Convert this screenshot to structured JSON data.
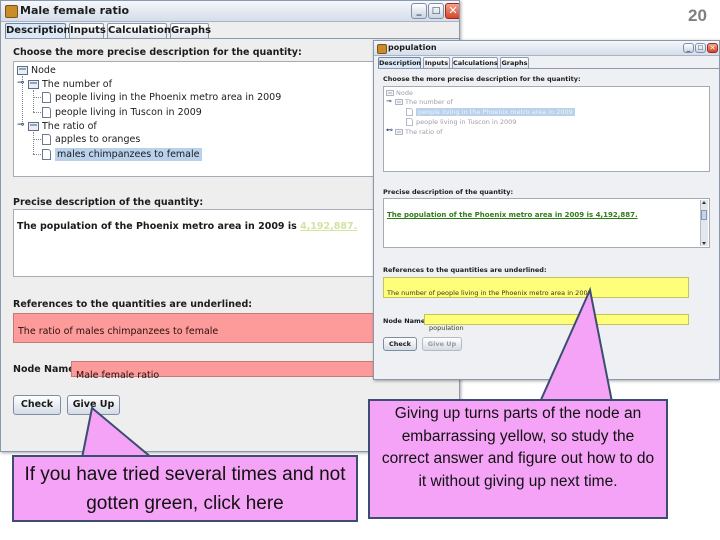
{
  "slide": {
    "page_number": "20"
  },
  "main_window": {
    "title": "Male female ratio",
    "tabs": [
      "Description",
      "Inputs",
      "Calculations",
      "Graphs"
    ],
    "choose_label": "Choose the more precise description for the quantity:",
    "tree": {
      "root": "Node",
      "groups": [
        {
          "label": "The number of",
          "items": [
            "people living in the Phoenix metro area in 2009",
            "people living in Tuscon in 2009"
          ]
        },
        {
          "label": "The ratio of",
          "items": [
            "apples to oranges",
            "males chimpanzees to female"
          ]
        }
      ]
    },
    "precise_label": "Precise description of the quantity:",
    "precise_text": "The population of the Phoenix metro area in 2009 is ",
    "precise_value": "4,192,887.",
    "references_label": "References to the quantities are underlined:",
    "references_text": "The ratio of males chimpanzees to female",
    "node_name_label": "Node Name:",
    "node_name_value": "Male female ratio",
    "check_label": "Check",
    "give_up_label": "Give Up"
  },
  "popup_window": {
    "title": "population",
    "tabs": [
      "Description",
      "Inputs",
      "Calculations",
      "Graphs"
    ],
    "choose_label": "Choose the more precise description for the quantity:",
    "tree": {
      "root": "Node",
      "group1": "The number of",
      "items": [
        "people living in the Phoenix metro area in 2009",
        "people living in Tuscon in 2009"
      ],
      "group2": "The ratio of"
    },
    "precise_label": "Precise description of the quantity:",
    "precise_text": "The population of the Phoenix metro area in 2009 is 4,192,887.",
    "references_label": "References to the quantities are underlined:",
    "references_text": "The number of people living in the Phoenix metro area in 2009",
    "node_name_label": "Node Name:",
    "node_name_value": "population",
    "check_label": "Check",
    "give_up_label": "Give Up"
  },
  "callouts": {
    "left": "If you have tried several times and not gotten green, click here",
    "right": "Giving up turns parts of the node an embarrassing yellow, so study the correct answer and figure out how to do it without giving up next time."
  },
  "colors": {
    "error_pink": "#fd9a9a",
    "giveup_yellow": "#fefe7a",
    "green_text": "#2f7d18",
    "selection": "#b9d1ea",
    "callout_pink": "#f5a3f7"
  }
}
